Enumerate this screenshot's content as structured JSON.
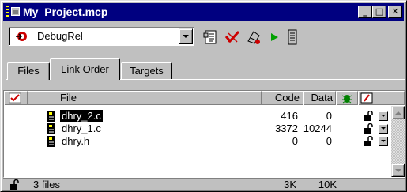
{
  "window": {
    "title": "My_Project.mcp"
  },
  "titlebar_buttons": {
    "minimize_glyph": "_",
    "maximize_glyph": "□",
    "close_glyph": "✕"
  },
  "toolbar": {
    "target_value": "DebugRel",
    "target_icon": "target-icon",
    "tools": [
      {
        "name": "target-settings-icon"
      },
      {
        "name": "synchronize-modification-dates-icon"
      },
      {
        "name": "make-icon"
      },
      {
        "name": "debug-run-icon"
      },
      {
        "name": "project-inspector-icon"
      }
    ]
  },
  "tabs": [
    {
      "label": "Files",
      "selected": false
    },
    {
      "label": "Link Order",
      "selected": true
    },
    {
      "label": "Targets",
      "selected": false
    }
  ],
  "columns": {
    "check_icon": "checkmark-icon",
    "file": "File",
    "code": "Code",
    "data": "Data",
    "debug_icon": "debug-bug-icon",
    "touch_icon": "pencil-icon"
  },
  "files": [
    {
      "name": "dhry_2.c",
      "code": "416",
      "data": "0",
      "selected": true
    },
    {
      "name": "dhry_1.c",
      "code": "3372",
      "data": "10244",
      "selected": false
    },
    {
      "name": "dhry.h",
      "code": "0",
      "data": "0",
      "selected": false
    }
  ],
  "status": {
    "count_text": "3 files",
    "code_total": "3K",
    "data_total": "10K"
  },
  "colors": {
    "title_bar": "#000080",
    "window_face": "#c0c0c0",
    "selection": "#000000",
    "target_icon_red": "#cc0000",
    "run_green": "#00a000"
  }
}
